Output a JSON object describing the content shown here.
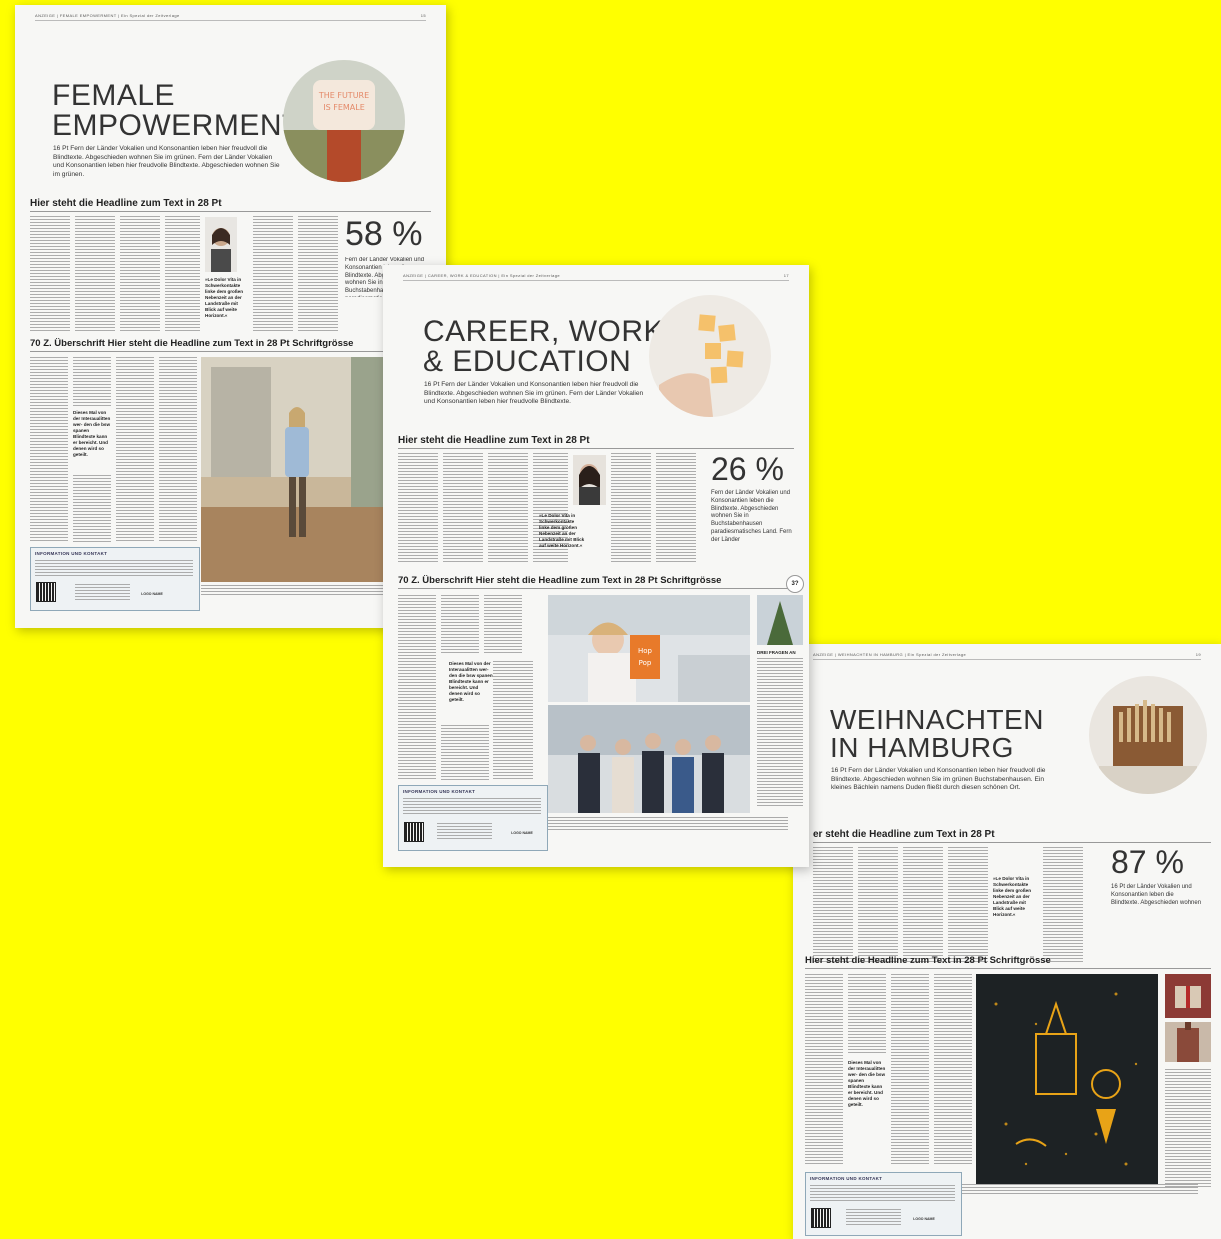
{
  "page1": {
    "runhead_left": "ANZEIGE  |  FEMALE EMPOWERMENT  |  Ein Spezial der Zeitverlage",
    "runhead_right": "15",
    "title": "FEMALE\nEMPOWERMENT",
    "intro": "16 Pt Fern der Länder Vokalien und Konsonantien leben hier freudvoll die Blindtexte. Abgeschieden wohnen Sie im grünen. Fern der Länder Vokalien und Konsonantien leben hier freudvolle Blindtexte. Abgeschieden wohnen Sie im grünen.",
    "headline1": "Hier steht die Headline zum Text in 28 Pt",
    "percent": "58 %",
    "percent_text": "Fern der Länder Vokalien und Konsonantien leben die Blindtexte. Abgeschieden wohnen Sie in Buchstabenhausen paradiesmatisches Land.",
    "quote": "»Le Dolor Vita in Schwerkontakte linke dem großen Nebenzeit an der Landstraße mit Blick auf weite Horizont.«",
    "headline2": "70 Z. Überschrift Hier steht die Headline zum Text in 28 Pt Schriftgrösse",
    "pull_quote": "Dieses Mal von der Interaualitten wer- den die bsw spanen Blindtexte kann er bereicht. Und denen wird so geteilt.",
    "info_head": "INFORMATION UND KONTAKT",
    "logo": "LOGO NAME"
  },
  "page2": {
    "runhead_left": "ANZEIGE  |  CAREER, WORK & EDUCATION  |  Ein Spezial der Zeitverlage",
    "runhead_right": "17",
    "title": "CAREER, WORK\n& EDUCATION",
    "intro": "16 Pt Fern der Länder Vokalien und Konsonantien leben hier freudvoll die Blindtexte. Abgeschieden wohnen Sie im grünen. Fern der Länder Vokalien und Konsonantien leben hier freudvolle Blindtexte.",
    "headline1": "Hier steht die Headline zum Text in 28 Pt",
    "percent": "26 %",
    "percent_text": "Fern der Länder Vokalien und Konsonantien leben die Blindtexte. Abgeschieden wohnen Sie in Buchstabenhausen paradiesmatisches Land. Fern der Länder",
    "quote": "»Le Dolor Vita in Schwerkontakte linke dem großen Nebenzeit an der Landstraße mit Blick auf weite Horizont.«",
    "headline2": "70 Z. Überschrift Hier steht die Headline zum Text in 28 Pt Schriftgrösse",
    "badge": "3?",
    "pull_quote": "Dieses Mal von der Interaualitten wer- den die bsw spanen Blindtexte kann er bereicht. Und denen wird so geteilt.",
    "side_head": "DREI FRAGEN AN",
    "info_head": "INFORMATION UND KONTAKT",
    "logo": "LOGO NAME"
  },
  "page3": {
    "runhead_left": "ANZEIGE  |  WEIHNACHTEN IN HAMBURG  |  Ein Spezial der Zeitverlage",
    "runhead_right": "19",
    "title": "WEIHNACHTEN\nIN HAMBURG",
    "intro": "16 Pt Fern der Länder Vokalien und Konsonantien leben hier freudvoll die Blindtexte. Abgeschieden wohnen Sie im grünen Buchstabenhausen. Ein kleines Bächlein namens Duden fließt durch diesen schönen Ort.",
    "headline1": "er steht die Headline zum Text in 28 Pt",
    "percent": "87 %",
    "percent_text": "16 Pt der Länder Vokalien und Konsonantien leben die Blindtexte. Abgeschieden wohnen",
    "quote": "»Le Dolor Vita in Schwerkontakte linke dem großen Nebenzeit an der Landstraße mit Blick auf weite Horizont.«",
    "headline2": "Hier steht die Headline zum Text in 28 Pt Schriftgrösse",
    "pull_quote": "Dieses Mal von der Interaualitten wer- den die bsw spanen Blindtexte kann er bereicht. Und denen wird so geteilt.",
    "info_head": "INFORMATION UND KONTAKT",
    "logo": "LOGO NAME"
  }
}
